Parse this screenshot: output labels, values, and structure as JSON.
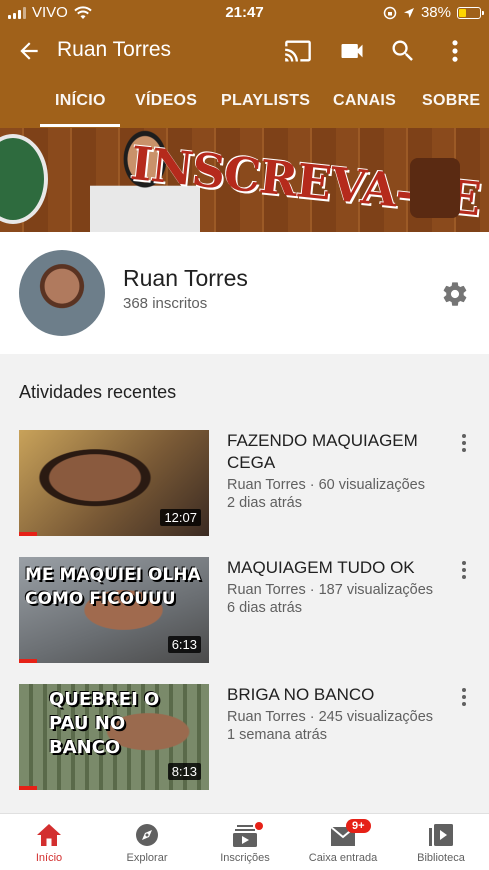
{
  "status_bar": {
    "carrier": "VIVO",
    "time": "21:47",
    "battery": "38%",
    "battery_level": 0.38
  },
  "app_bar": {
    "title": "Ruan Torres",
    "icons": [
      "back-arrow-icon",
      "cast-icon",
      "video-camera-icon",
      "search-icon",
      "more-vert-icon"
    ]
  },
  "tabs": [
    {
      "label": "INÍCIO",
      "active": true
    },
    {
      "label": "VÍDEOS",
      "active": false
    },
    {
      "label": "PLAYLISTS",
      "active": false
    },
    {
      "label": "CANAIS",
      "active": false
    },
    {
      "label": "SOBRE",
      "active": false
    }
  ],
  "banner": {
    "text": "INSCREVA-SE"
  },
  "channel": {
    "name": "Ruan Torres",
    "subscribers": "368 inscritos"
  },
  "recent": {
    "title": "Atividades recentes",
    "videos": [
      {
        "title": "FAZENDO MAQUIAGEM CEGA",
        "channel_views": "Ruan Torres · 60 visualizações",
        "age": "2 dias atrás",
        "duration": "12:07",
        "thumb_caption": ""
      },
      {
        "title": "MAQUIAGEM TUDO OK",
        "channel_views": "Ruan Torres · 187 visualizações",
        "age": "6 dias atrás",
        "duration": "6:13",
        "thumb_caption": "ME MAQUIEI OLHA COMO FICOUUU"
      },
      {
        "title": "BRIGA NO BANCO",
        "channel_views": "Ruan Torres · 245 visualizações",
        "age": "1 semana atrás",
        "duration": "8:13",
        "thumb_caption": "QUEBREI O PAU NO BANCO"
      }
    ]
  },
  "bottom_nav": [
    {
      "label": "Início",
      "icon": "home-icon",
      "active": true
    },
    {
      "label": "Explorar",
      "icon": "compass-icon",
      "active": false
    },
    {
      "label": "Inscrições",
      "icon": "subscriptions-icon",
      "active": false
    },
    {
      "label": "Caixa entrada",
      "icon": "inbox-icon",
      "active": false,
      "badge": "9+"
    },
    {
      "label": "Biblioteca",
      "icon": "library-icon",
      "active": false
    }
  ],
  "colors": {
    "header": "#a0611a",
    "accent_red": "#e62117",
    "active_nav": "#d32f2f"
  }
}
